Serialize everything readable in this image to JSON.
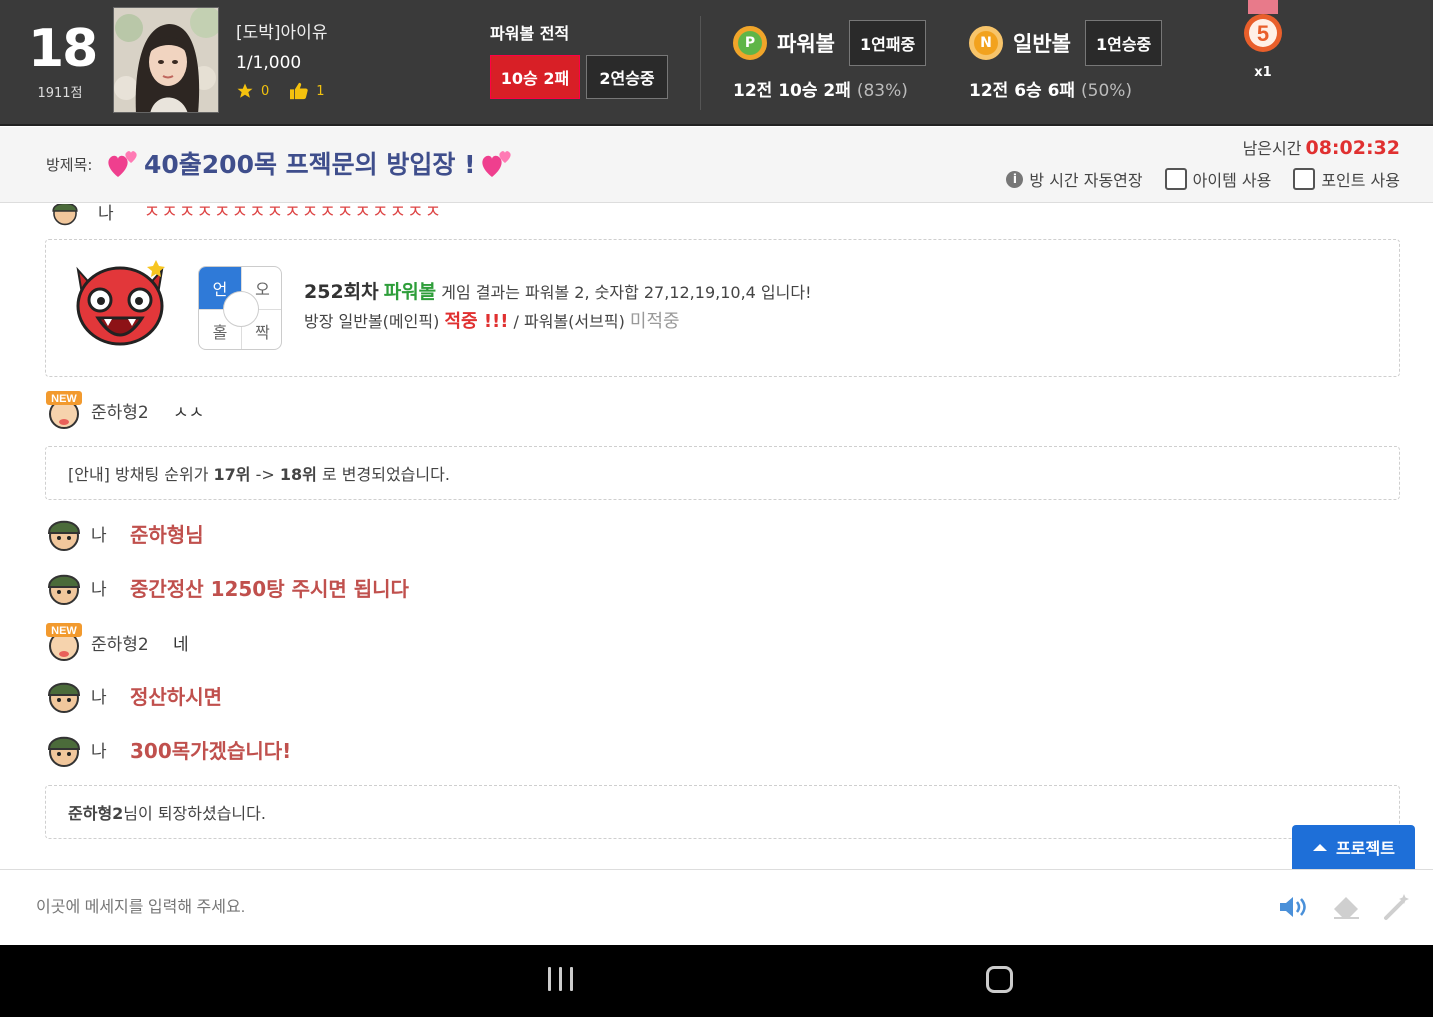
{
  "header": {
    "rank": "18",
    "score": "1911점",
    "player_name": "[도박]아이유",
    "player_value": "1/1,000",
    "stars": "0",
    "likes": "1",
    "record_title": "파워볼 전적",
    "record_wl": "10승 2패",
    "record_streak": "2연승중",
    "powerball": {
      "icon_letter": "P",
      "name": "파워볼",
      "streak": "1연패중",
      "stat": "12전 10승 2패",
      "pct": "(83%)"
    },
    "normalball": {
      "icon_letter": "N",
      "name": "일반볼",
      "streak": "1연승중",
      "stat": "12전 6승 6패",
      "pct": "(50%)"
    },
    "medal_num": "5",
    "medal_mult": "x1"
  },
  "room": {
    "label": "방제목:",
    "title": "40출200목 프젝문의 방입장 !",
    "remain_label": "남은시간",
    "remain_time": "08:02:32",
    "opt_auto": "방 시간 자동연장",
    "opt_item": "아이템 사용",
    "opt_point": "포인트 사용"
  },
  "chat": {
    "strip_user": "나",
    "strip_text": "ㅈㅈㅈㅈㅈㅈㅈㅈㅈㅈㅈㅈㅈㅈㅈㅈㅈ",
    "result": {
      "odd_even": {
        "tl": "언",
        "tr": "오",
        "bl": "홀",
        "br": "짝"
      },
      "round": "252회차",
      "game": "파워볼",
      "line1_rest": "게임 결과는 파워볼 2, 숫자합 27,12,19,10,4 입니다!",
      "line2_pre": "방장 일반볼(메인픽)",
      "hit": "적중 !!!",
      "line2_mid": "/ 파워볼(서브픽)",
      "miss": "미적중"
    },
    "messages": [
      {
        "user": "준하형2",
        "text": "ㅅㅅ"
      },
      {
        "user": "나",
        "text": "준하형님"
      },
      {
        "user": "나",
        "text": "중간정산 1250탕 주시면 됩니다"
      },
      {
        "user": "준하형2",
        "text": "네"
      },
      {
        "user": "나",
        "text": "정산하시면"
      },
      {
        "user": "나",
        "text": "300목가겠습니다!"
      }
    ],
    "notice1": {
      "pre": "[안내] 방채팅 순위가",
      "from": "17위",
      "arrow": "->",
      "to": "18위",
      "post": "로 변경되었습니다."
    },
    "notice2": {
      "name": "준하형2",
      "post": "님이 퇴장하셨습니다."
    }
  },
  "project_button": "프로젝트",
  "input": {
    "placeholder": "이곳에 메세지를 입력해 주세요."
  },
  "icons": {
    "speaker": "speaker-icon",
    "eraser": "eraser-icon",
    "magic": "magic-wand-icon",
    "nav_recents": "recent-apps-icon",
    "nav_home": "home-icon"
  },
  "colors": {
    "accent_red": "#d81f26",
    "title_blue": "#3f4e8c",
    "chat_red": "#c0504d",
    "project_blue": "#1e6fd8",
    "hit_red": "#e03030",
    "game_green": "#2e9e3a"
  }
}
